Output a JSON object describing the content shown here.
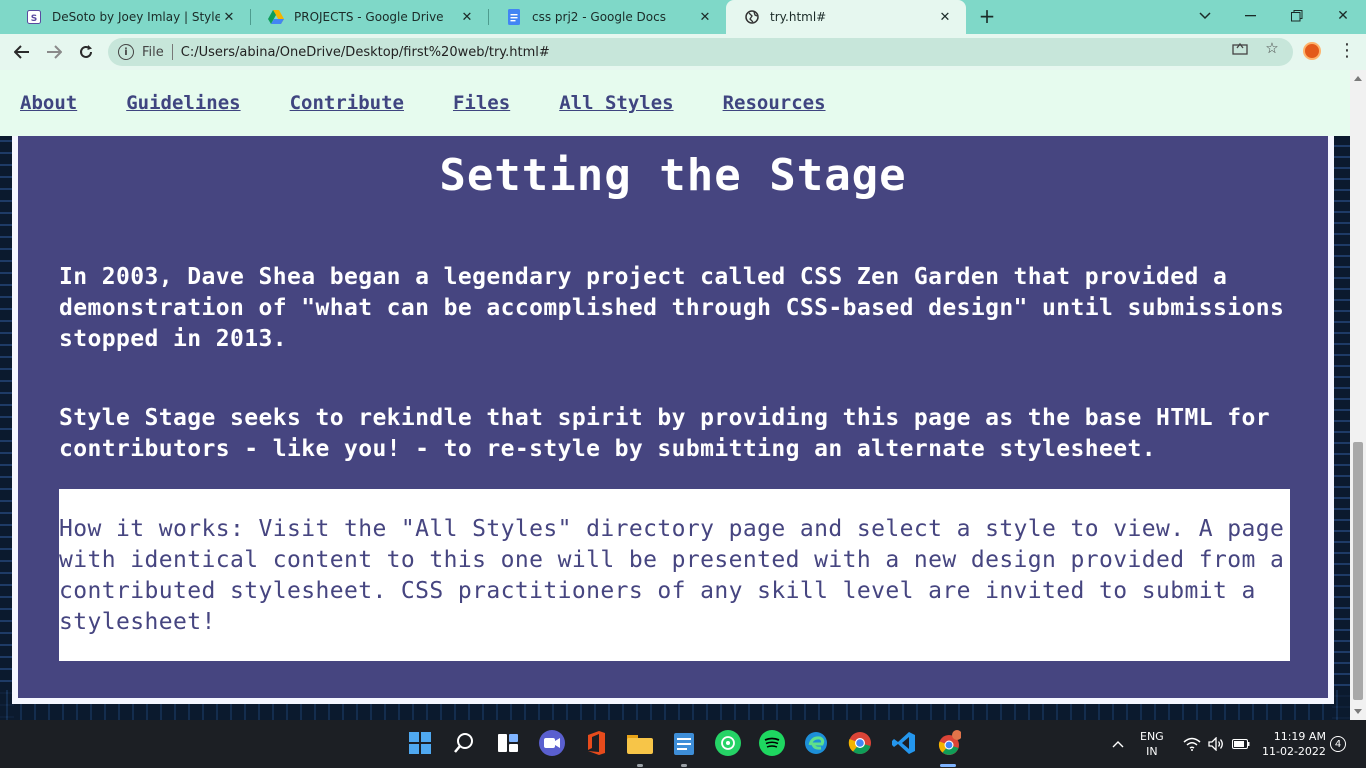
{
  "browser": {
    "tabs": [
      {
        "title": "DeSoto by Joey Imlay | Style Stag",
        "icon": "style-stage-favicon",
        "active": false
      },
      {
        "title": "PROJECTS - Google Drive",
        "icon": "google-drive-favicon",
        "active": false
      },
      {
        "title": "css prj2 - Google Docs",
        "icon": "google-docs-favicon",
        "active": false
      },
      {
        "title": "try.html#",
        "icon": "globe-favicon",
        "active": true
      }
    ],
    "address": {
      "scheme_label": "File",
      "url": "C:/Users/abina/OneDrive/Desktop/first%20web/try.html#"
    },
    "colors": {
      "tabbar": "#7fd8c8",
      "toolbar": "#e6f7ef",
      "omnibox": "#c7e6da"
    }
  },
  "site": {
    "nav": [
      "About",
      "Guidelines",
      "Contribute",
      "Files",
      "All Styles",
      "Resources"
    ],
    "title": "Setting the Stage",
    "paragraphs": [
      "In 2003, Dave Shea began a legendary project called CSS Zen Garden that provided a demonstration of \"what can be accomplished through CSS-based design\" until submissions stopped in 2013.",
      "Style Stage seeks to rekindle that spirit by providing this page as the base HTML for contributors - like you! - to re-style by submitting an alternate stylesheet."
    ],
    "how_it_works": "How it works: Visit the \"All Styles\" directory page and select a style to view. A page with identical content to this one will be presented with a new design provided from a contributed stylesheet. CSS practitioners of any skill level are invited to submit a stylesheet!",
    "colors": {
      "panel": "#464580",
      "nav_bg": "#e6fbee",
      "nav_link": "#3f4580"
    }
  },
  "taskbar": {
    "apps": [
      "windows-start",
      "search",
      "task-view",
      "teams-chat",
      "office",
      "file-explorer",
      "notepad",
      "whatsapp",
      "spotify",
      "edge",
      "chrome",
      "vs-code",
      "chrome-profile"
    ],
    "language": "ENG",
    "region": "IN",
    "time": "11:19 AM",
    "date": "11-02-2022",
    "notifications": "4"
  }
}
